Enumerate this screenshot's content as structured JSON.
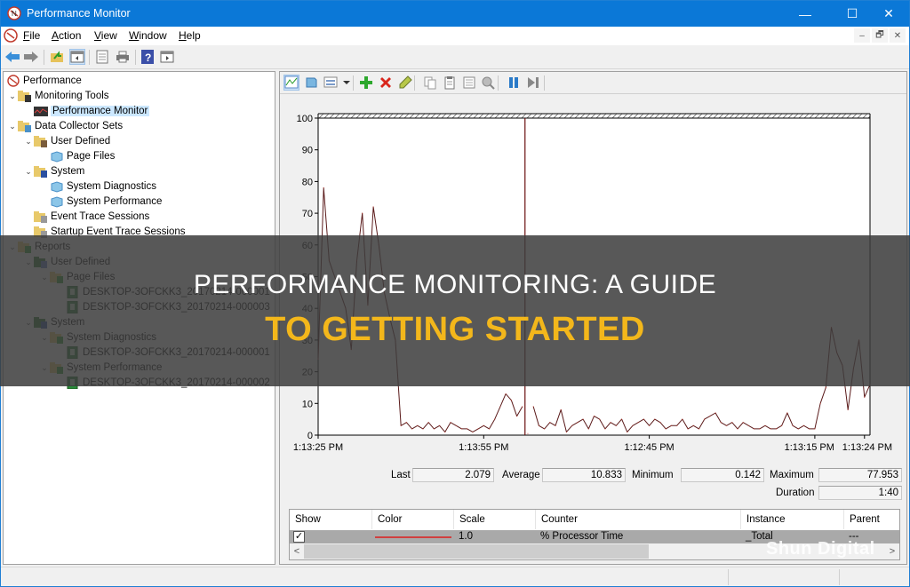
{
  "window": {
    "title": "Performance Monitor",
    "controls": {
      "minimize": "—",
      "maximize": "☐",
      "close": "✕"
    }
  },
  "menubar": {
    "items": [
      {
        "label": "File",
        "accel": "F",
        "rest": "ile"
      },
      {
        "label": "Action",
        "accel": "A",
        "rest": "ction"
      },
      {
        "label": "View",
        "accel": "V",
        "rest": "iew"
      },
      {
        "label": "Window",
        "accel": "W",
        "rest": "indow"
      },
      {
        "label": "Help",
        "accel": "H",
        "rest": "elp"
      }
    ],
    "mdi": {
      "minimize": "–",
      "restore": "🗗",
      "close": "✕"
    }
  },
  "toolbar": {
    "icons": [
      "back-icon",
      "forward-icon",
      "up-folder-icon",
      "show-hide-tree-icon",
      "properties-icon",
      "print-icon",
      "help-icon",
      "show-action-pane-icon"
    ]
  },
  "tree": {
    "items": [
      {
        "label": "Performance",
        "level": 0,
        "icon": "performance-icon",
        "expanded": null
      },
      {
        "label": "Monitoring Tools",
        "level": 1,
        "icon": "folder-tools-icon",
        "expanded": true
      },
      {
        "label": "Performance Monitor",
        "level": 2,
        "icon": "perfmon-icon",
        "expanded": null,
        "selected": true
      },
      {
        "label": "Data Collector Sets",
        "level": 1,
        "icon": "folder-dcs-icon",
        "expanded": true
      },
      {
        "label": "User Defined",
        "level": 2,
        "icon": "folder-user-icon",
        "expanded": true
      },
      {
        "label": "Page Files",
        "level": 3,
        "icon": "collector-set-icon",
        "expanded": null
      },
      {
        "label": "System",
        "level": 2,
        "icon": "folder-system-icon",
        "expanded": true
      },
      {
        "label": "System Diagnostics",
        "level": 3,
        "icon": "collector-set-icon",
        "expanded": null
      },
      {
        "label": "System Performance",
        "level": 3,
        "icon": "collector-set-icon",
        "expanded": null
      },
      {
        "label": "Event Trace Sessions",
        "level": 2,
        "icon": "folder-trace-icon",
        "expanded": null
      },
      {
        "label": "Startup Event Trace Sessions",
        "level": 2,
        "icon": "folder-trace-icon",
        "expanded": null
      },
      {
        "label": "Reports",
        "level": 1,
        "icon": "folder-reports-icon",
        "expanded": true
      },
      {
        "label": "User Defined",
        "level": 2,
        "icon": "report-user-icon",
        "expanded": true
      },
      {
        "label": "Page Files",
        "level": 3,
        "icon": "folder-report-icon",
        "expanded": true
      },
      {
        "label": "DESKTOP-3OFCKK3_20170214-000001",
        "level": 4,
        "icon": "report-icon",
        "expanded": null
      },
      {
        "label": "DESKTOP-3OFCKK3_20170214-000003",
        "level": 4,
        "icon": "report-icon",
        "expanded": null
      },
      {
        "label": "System",
        "level": 2,
        "icon": "report-system-icon",
        "expanded": true
      },
      {
        "label": "System Diagnostics",
        "level": 3,
        "icon": "folder-report-icon",
        "expanded": true
      },
      {
        "label": "DESKTOP-3OFCKK3_20170214-000001",
        "level": 4,
        "icon": "report-icon",
        "expanded": null
      },
      {
        "label": "System Performance",
        "level": 3,
        "icon": "folder-report-icon",
        "expanded": true
      },
      {
        "label": "DESKTOP-3OFCKK3_20170214-000002",
        "level": 4,
        "icon": "report-icon",
        "expanded": null
      }
    ]
  },
  "graph_toolbar": {
    "icons": [
      "view-graph-icon",
      "view-current-activity-icon",
      "change-graph-type-icon",
      "dropdown-arrow-icon",
      "add-counter-icon",
      "delete-counter-icon",
      "highlight-icon",
      "copy-properties-icon",
      "paste-counter-list-icon",
      "properties-icon",
      "zoom-icon",
      "freeze-display-icon",
      "update-data-icon"
    ]
  },
  "chart_data": {
    "type": "line",
    "title": "",
    "xlabel": "",
    "ylabel": "",
    "ylim": [
      0,
      100
    ],
    "yticks": [
      0,
      10,
      20,
      30,
      40,
      50,
      60,
      70,
      80,
      90,
      100
    ],
    "xtick_labels": [
      "1:13:25 PM",
      "1:13:55 PM",
      "1:12:45 PM",
      "1:13:15 PM",
      "1:13:24 PM"
    ],
    "xtick_positions": [
      0,
      30,
      60,
      90,
      99
    ],
    "cursor_sample": 37,
    "grid": false,
    "series": [
      {
        "name": "% Processor Time",
        "color": "#c0392b",
        "values": [
          24,
          78,
          55,
          50,
          45,
          40,
          27,
          55,
          70,
          41,
          72,
          60,
          45,
          37,
          30,
          3,
          4,
          2,
          3,
          2,
          4,
          2,
          3,
          1,
          4,
          3,
          2,
          2,
          1,
          2,
          3,
          2,
          5,
          9,
          13,
          11,
          6,
          9,
          0.5,
          9,
          3,
          2,
          4,
          3,
          8,
          1,
          3,
          4,
          5,
          2,
          6,
          5,
          2,
          4,
          3,
          5,
          1,
          3,
          4,
          5,
          3,
          5,
          4,
          2,
          3,
          3,
          5,
          2,
          3,
          2,
          5,
          6,
          7,
          4,
          3,
          4,
          2,
          4,
          3,
          2,
          2,
          3,
          2,
          2,
          3,
          7,
          3,
          2,
          3,
          2,
          2,
          10,
          15,
          34,
          26,
          22,
          8,
          21,
          30,
          12,
          16
        ]
      }
    ]
  },
  "stats": {
    "last_label": "Last",
    "last": "2.079",
    "average_label": "Average",
    "average": "10.833",
    "minimum_label": "Minimum",
    "minimum": "0.142",
    "maximum_label": "Maximum",
    "maximum": "77.953",
    "duration_label": "Duration",
    "duration": "1:40"
  },
  "counter_table": {
    "headers": [
      "Show",
      "Color",
      "Scale",
      "Counter",
      "Instance",
      "Parent"
    ],
    "rows": [
      {
        "show": true,
        "color": "#d04040",
        "scale": "1.0",
        "counter": "% Processor Time",
        "instance": "_Total",
        "parent": "---"
      }
    ]
  },
  "overlay": {
    "line1": "PERFORMANCE MONITORING: A GUIDE",
    "line2": "TO GETTING STARTED"
  },
  "watermark": "Shun Digital"
}
